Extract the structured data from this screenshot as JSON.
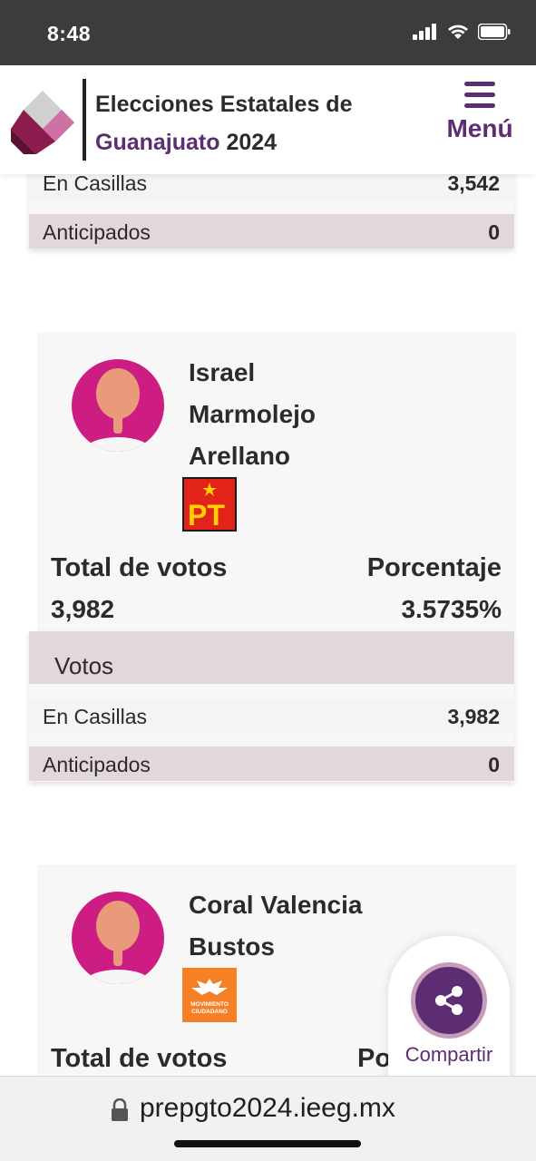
{
  "status_bar": {
    "time": "8:48"
  },
  "header": {
    "title_line1": "Elecciones Estatales de",
    "title_accent": "Guanajuato",
    "title_year": "2024",
    "menu_label": "Menú"
  },
  "prev_card": {
    "rows": [
      {
        "label": "En Casillas",
        "value": "3,542"
      },
      {
        "label": "Anticipados",
        "value": "0"
      }
    ]
  },
  "candidates": [
    {
      "name_lines": [
        "Israel",
        "Marmolejo",
        "Arellano"
      ],
      "party_logo": "pt-logo",
      "party_text": "PT",
      "total_label": "Total de votos",
      "total_value": "3,982",
      "pct_label": "Porcentaje",
      "pct_value": "3.5735%",
      "votos_header": "Votos",
      "rows": [
        {
          "label": "En Casillas",
          "value": "3,982"
        },
        {
          "label": "Anticipados",
          "value": "0"
        }
      ]
    },
    {
      "name_lines": [
        "Coral Valencia",
        "Bustos"
      ],
      "party_logo": "movimiento-ciudadano-logo",
      "party_text_1": "MOVIMIENTO",
      "party_text_2": "CIUDADANO",
      "total_label": "Total de votos",
      "pct_label_partial": "Po"
    }
  ],
  "share": {
    "label": "Compartir"
  },
  "browser": {
    "url": "prepgto2024.ieeg.mx"
  },
  "colors": {
    "brand_purple": "#5c2d73",
    "avatar_magenta": "#cd1d83",
    "row_alt": "#e2d7dd",
    "pt_red": "#e2231a",
    "mc_orange": "#f58025"
  }
}
